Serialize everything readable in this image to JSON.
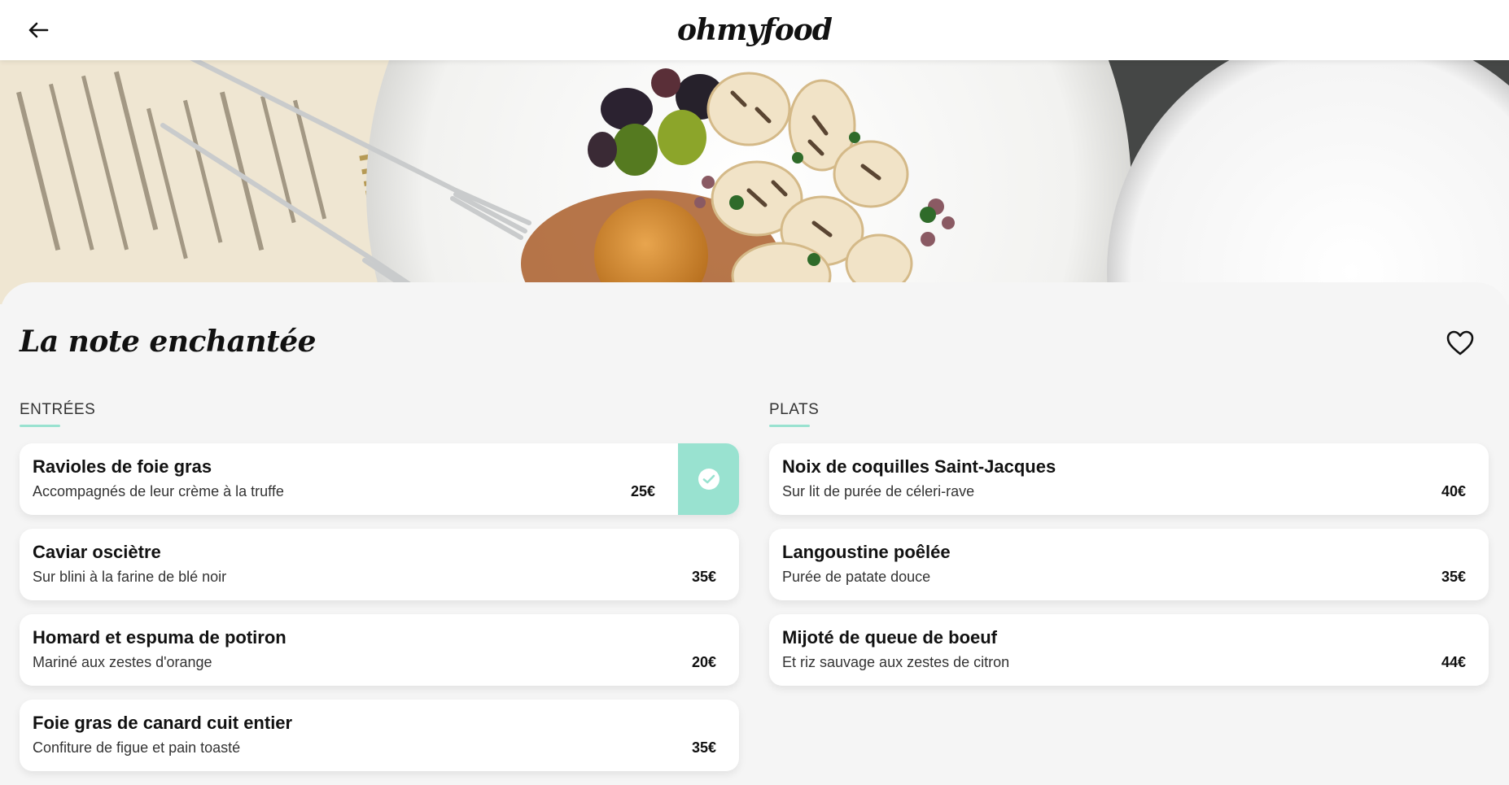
{
  "header": {
    "back_icon": "arrow-left-icon",
    "logo": "ohmyfood"
  },
  "restaurant": {
    "name": "La note enchantée",
    "favorite_icon": "heart-outline-icon"
  },
  "colors": {
    "accent": "#99e2d0",
    "background": "#f5f5f5",
    "card": "#ffffff"
  },
  "menu": {
    "entrees": {
      "title": "ENTRÉES",
      "items": [
        {
          "name": "Ravioles de foie gras",
          "desc": "Accompagnés de leur crème à la truffe",
          "price": "25€"
        },
        {
          "name": "Caviar osciètre",
          "desc": "Sur blini à la farine de blé noir",
          "price": "35€"
        },
        {
          "name": "Homard et espuma de potiron",
          "desc": "Mariné aux zestes d'orange",
          "price": "20€"
        },
        {
          "name": "Foie gras de canard cuit entier",
          "desc": "Confiture de figue et pain toasté",
          "price": "35€"
        }
      ]
    },
    "plats": {
      "title": "PLATS",
      "items": [
        {
          "name": "Noix de coquilles Saint-Jacques",
          "desc": "Sur lit de purée de céleri-rave",
          "price": "40€"
        },
        {
          "name": "Langoustine poêlée",
          "desc": "Purée de patate douce",
          "price": "35€"
        },
        {
          "name": "Mijoté de queue de boeuf",
          "desc": "Et riz sauvage aux zestes de citron",
          "price": "44€"
        }
      ]
    }
  }
}
